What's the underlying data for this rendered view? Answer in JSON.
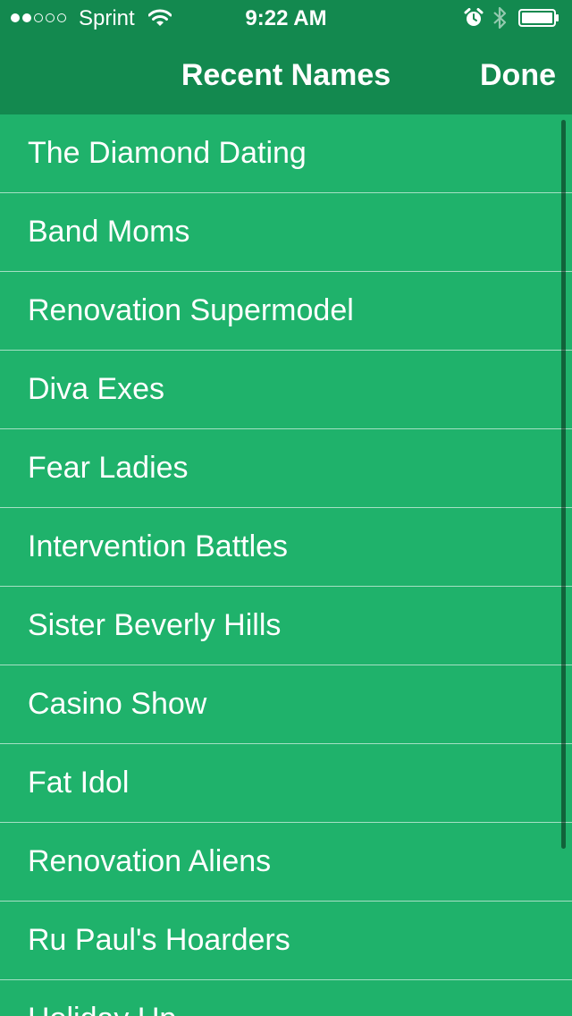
{
  "status_bar": {
    "signal": {
      "filled_dots": 2,
      "total_dots": 5
    },
    "carrier": "Sprint",
    "time": "9:22 AM",
    "icons": [
      "wifi-icon",
      "alarm-icon",
      "bluetooth-icon",
      "battery-icon"
    ]
  },
  "nav": {
    "title": "Recent Names",
    "done_label": "Done"
  },
  "names": [
    "The Diamond Dating",
    "Band Moms",
    "Renovation Supermodel",
    "Diva Exes",
    "Fear Ladies",
    "Intervention Battles",
    "Sister Beverly Hills",
    "Casino Show",
    "Fat Idol",
    "Renovation Aliens",
    "Ru Paul's Hoarders",
    "Holiday Up"
  ],
  "colors": {
    "list_background": "#1fb26b",
    "bar_background": "#13894f",
    "text": "#ffffff"
  }
}
